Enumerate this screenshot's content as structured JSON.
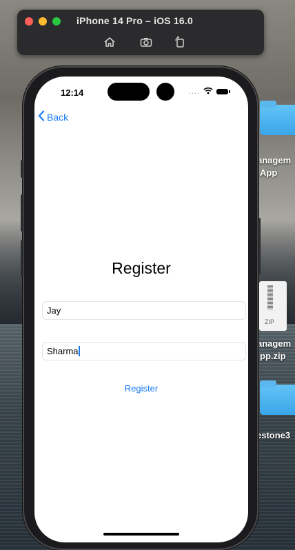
{
  "simulator": {
    "title": "iPhone 14 Pro – iOS 16.0",
    "tools": [
      "home-icon",
      "screenshot-icon",
      "rotate-icon"
    ]
  },
  "desktop": {
    "items": [
      {
        "label_line1": "anagem",
        "label_line2": "App",
        "icon": "folder-icon"
      },
      {
        "label_line1": "anagem",
        "label_line2": "pp.zip",
        "icon": "zip-file-icon",
        "badge": "ZIP"
      },
      {
        "label_line1": "estone3",
        "icon": "folder-icon"
      }
    ]
  },
  "status_bar": {
    "time": "12:14",
    "dots": "....",
    "icons": [
      "wifi-icon",
      "battery-icon"
    ]
  },
  "nav": {
    "back_label": "Back"
  },
  "form": {
    "title": "Register",
    "first_name_value": "Jay",
    "last_name_value": "Sharma",
    "submit_label": "Register"
  },
  "colors": {
    "accent": "#1a7cf5",
    "screen_bg": "#ffffff",
    "field_border": "#e5e5e8"
  }
}
